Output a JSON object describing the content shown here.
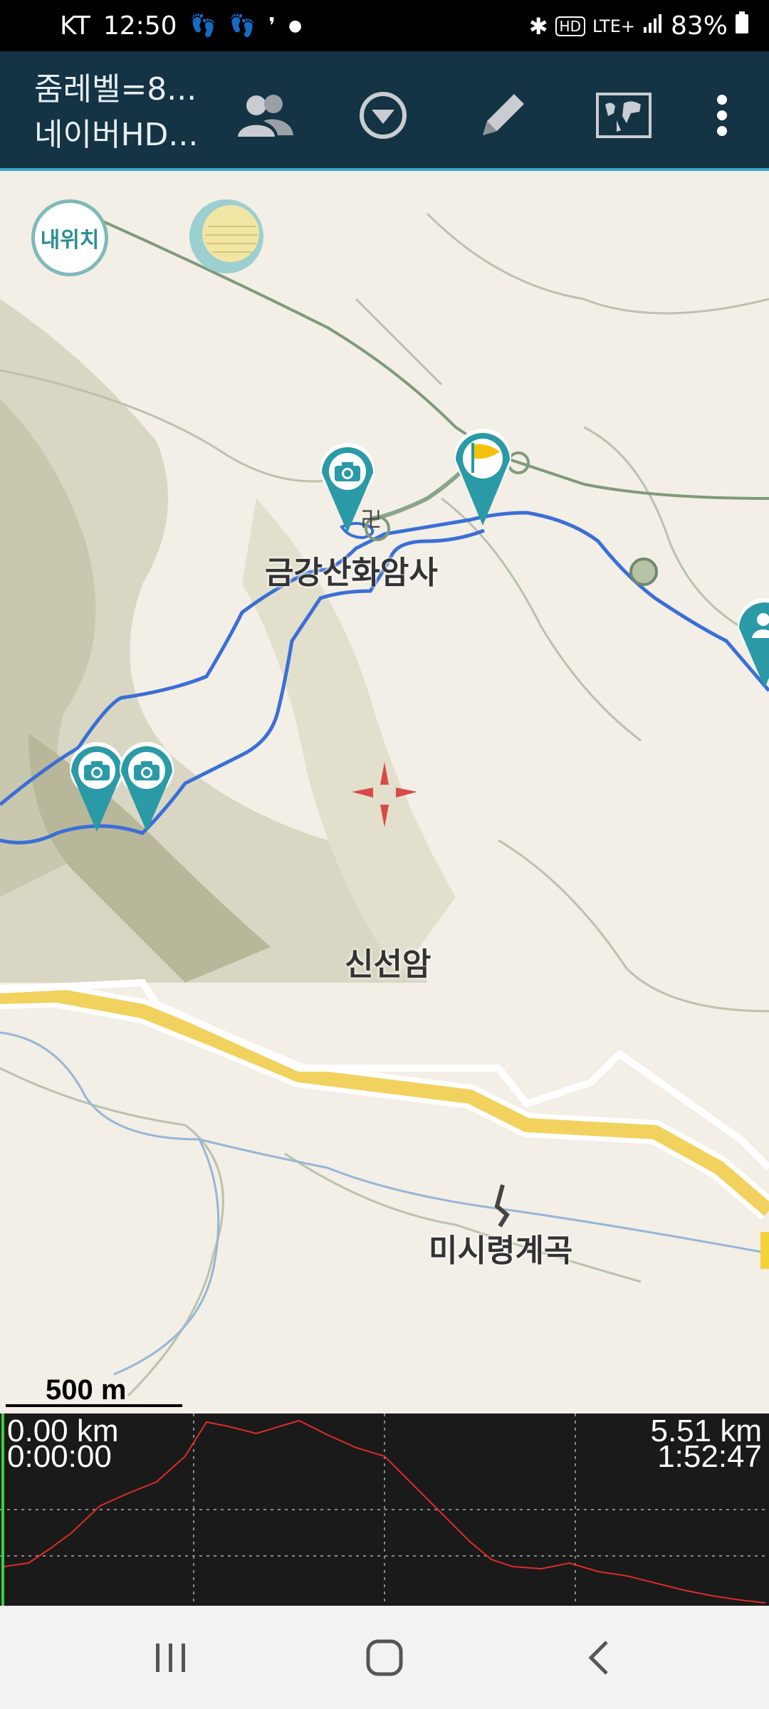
{
  "status_bar": {
    "carrier": "KT",
    "time": "12:50",
    "hd_label": "HD",
    "network": "LTE+",
    "battery": "83%"
  },
  "toolbar": {
    "title_line1": "줌레벨=8...",
    "title_line2": "네이버HD..."
  },
  "map": {
    "my_location_label": "내위치",
    "places": {
      "temple": "금강산화암사",
      "hermitage": "신선암",
      "valley": "미시령계곡"
    },
    "scale_label": "500 m",
    "colors": {
      "track": "#3a6fd6",
      "pin": "#2a9aa6",
      "road": "#f2d25e",
      "flag": "#f4c20d"
    }
  },
  "elevation": {
    "start_distance": "0.00 km",
    "start_time": "0:00:00",
    "end_distance": "5.51 km",
    "end_time": "1:52:47"
  }
}
